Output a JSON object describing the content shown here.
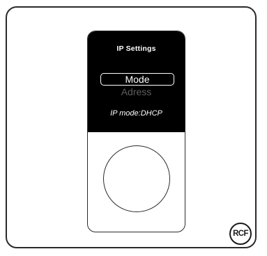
{
  "screen": {
    "title": "IP Settings",
    "menu": {
      "selected": "Mode",
      "next": "Adress"
    },
    "status": "IP mode:DHCP"
  },
  "brand": {
    "logo_text": "RCF"
  },
  "colors": {
    "screen_background": "#000000",
    "screen_text": "#ffffff",
    "dimmed_text": "#5e5e5e",
    "panel": "#ffffff",
    "outline": "#2a2a2a"
  }
}
